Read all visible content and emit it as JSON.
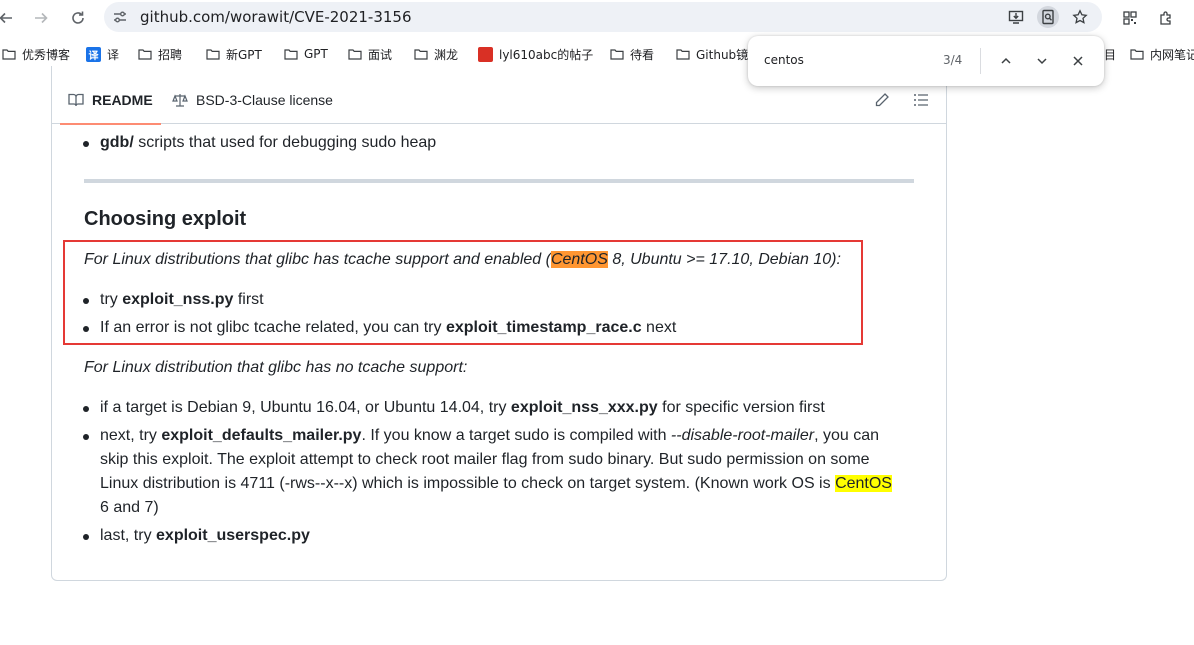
{
  "browser": {
    "url": "github.com/worawit/CVE-2021-3156",
    "find": {
      "query": "centos",
      "count": "3/4"
    },
    "bookmarks": [
      {
        "label": "优秀博客",
        "icon": "folder-icon"
      },
      {
        "label": "译",
        "icon": "translate-icon",
        "badge": "译",
        "badge_color": "#1a73e8"
      },
      {
        "label": "招聘",
        "icon": "folder-icon"
      },
      {
        "label": "新GPT",
        "icon": "folder-icon"
      },
      {
        "label": "GPT",
        "icon": "folder-icon"
      },
      {
        "label": "面试",
        "icon": "folder-icon"
      },
      {
        "label": "渊龙",
        "icon": "folder-icon"
      },
      {
        "label": "lyl610abc的帖子",
        "icon": "site-icon",
        "badge_color": "#d93025"
      },
      {
        "label": "待看",
        "icon": "folder-icon"
      },
      {
        "label": "Github镜",
        "icon": "folder-icon"
      },
      {
        "label": "目",
        "icon": ""
      },
      {
        "label": "内网笔记",
        "icon": "folder-icon"
      }
    ]
  },
  "readme": {
    "tabs": {
      "readme": "README",
      "license": "BSD-3-Clause license"
    },
    "gdb_item": {
      "bold": "gdb/",
      "text": " scripts that used for debugging sudo heap"
    },
    "heading": "Choosing exploit",
    "intro_tcache": {
      "before": "For Linux distributions that glibc has tcache support and enabled (",
      "match": "CentOS",
      "after": " 8, Ubuntu >= 17.10, Debian 10):"
    },
    "tcache_items": [
      {
        "pre": "try ",
        "bold": "exploit_nss.py",
        "post": " first"
      },
      {
        "pre": "If an error is not glibc tcache related, you can try ",
        "bold": "exploit_timestamp_race.c",
        "post": " next"
      }
    ],
    "intro_no_tcache": "For Linux distribution that glibc has no tcache support:",
    "no_tcache_items": {
      "item1": {
        "pre": "if a target is Debian 9, Ubuntu 16.04, or Ubuntu 14.04, try ",
        "bold": "exploit_nss_xxx.py",
        "post": " for specific version first"
      },
      "item2": {
        "pre": "next, try ",
        "bold": "exploit_defaults_mailer.py",
        "mid": ". If you know a target sudo is compiled with ",
        "italic": "--disable-root-mailer",
        "post": ", you can skip this exploit. The exploit attempt to check root mailer flag from sudo binary. But sudo permission on some Linux distribution is 4711 (-rws--x--x) which is impossible to check on target system. (Known work OS is ",
        "match": "CentOS",
        "end": " 6 and 7)"
      },
      "item3": {
        "pre": "last, try ",
        "bold": "exploit_userspec.py"
      }
    }
  },
  "colors": {
    "current_match": "#ff9632",
    "other_match": "#ffff00",
    "annotation_box": "#e53935",
    "tab_underline": "#fd8c73"
  }
}
